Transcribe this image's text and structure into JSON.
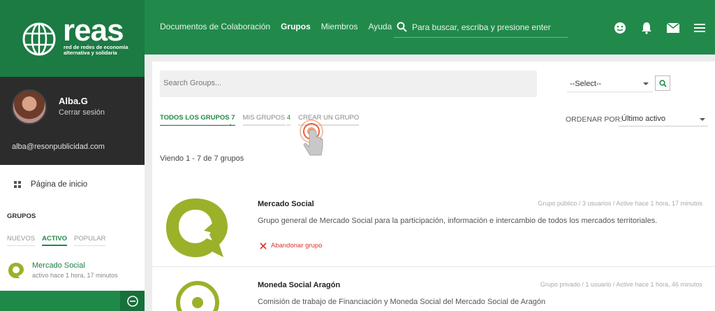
{
  "brand": {
    "name": "reas",
    "tagline_line1": "red de redes de economía",
    "tagline_line2": "alternativa y solidaria"
  },
  "nav": {
    "items": [
      {
        "label": "Documentos de Colaboración",
        "active": false
      },
      {
        "label": "Grupos",
        "active": true
      },
      {
        "label": "Miembros",
        "active": false
      },
      {
        "label": "Ayuda",
        "active": false
      }
    ],
    "search_placeholder": "Para buscar, escriba y presione enter"
  },
  "top_icons": [
    "smiley-icon",
    "bell-icon",
    "mail-icon",
    "hamburger-menu-icon"
  ],
  "profile": {
    "name": "Alba.G",
    "logout": "Cerrar sesión",
    "email": "alba@resonpublicidad.com"
  },
  "sidebar": {
    "home_label": "Página de inicio",
    "groups_title": "GRUPOS",
    "tabs": [
      {
        "label": "NUEVOS",
        "active": false
      },
      {
        "label": "ACTIVO",
        "active": true
      },
      {
        "label": "POPULAR",
        "active": false
      }
    ],
    "group": {
      "name": "Mercado Social",
      "meta": "activo hace 1 hora, 17 minutos"
    }
  },
  "main": {
    "search_placeholder": "Search Groups...",
    "select_value": "--Select--",
    "tabs": [
      {
        "label": "TODOS LOS GRUPOS",
        "count": "7",
        "active": true
      },
      {
        "label": "MIS GRUPOS",
        "count": "4",
        "active": false
      },
      {
        "label": "CREAR UN GRUPO",
        "count": "",
        "active": false
      }
    ],
    "order_label": "ORDENAR POR:",
    "order_value": "Último activo",
    "count_text": "Viendo 1 - 7 de 7 grupos",
    "groups": [
      {
        "name": "Mercado Social",
        "meta": "Grupo público / 3 usuarios / Active hace 1 hora, 17 minutos",
        "description": "Grupo general de Mercado Social para la participación, información e intercambio de todos los mercados territoriales.",
        "action": "Abandonar grupo"
      },
      {
        "name": "Moneda Social Aragón",
        "meta": "Grupo privado / 1 usuario / Active hace 1 hora, 46 minutos",
        "description": "Comisión de trabajo de Financiación y Moneda Social del Mercado Social de Aragón"
      }
    ]
  },
  "colors": {
    "brand_green": "#218a4a",
    "dark_green": "#1c7a43",
    "logo_olive": "#9bb12a",
    "danger": "#d9342b"
  }
}
